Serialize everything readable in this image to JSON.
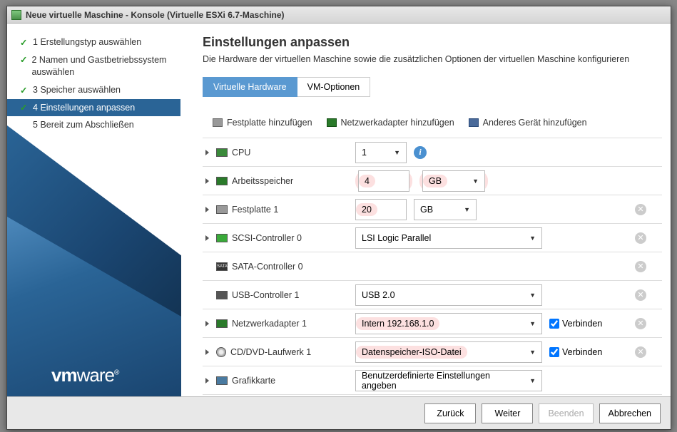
{
  "window": {
    "title": "Neue virtuelle Maschine - Konsole (Virtuelle ESXi 6.7-Maschine)"
  },
  "steps": [
    {
      "num": "1",
      "label": "Erstellungstyp auswählen",
      "done": true
    },
    {
      "num": "2",
      "label": "Namen und Gastbetriebssystem auswählen",
      "done": true
    },
    {
      "num": "3",
      "label": "Speicher auswählen",
      "done": true
    },
    {
      "num": "4",
      "label": "Einstellungen anpassen",
      "active": true
    },
    {
      "num": "5",
      "label": "Bereit zum Abschließen",
      "future": true
    }
  ],
  "main": {
    "heading": "Einstellungen anpassen",
    "desc": "Die Hardware der virtuellen Maschine sowie die zusätzlichen Optionen der virtuellen Maschine konfigurieren"
  },
  "tabs": {
    "hw": "Virtuelle Hardware",
    "opts": "VM-Optionen"
  },
  "toolbar": {
    "add_disk": "Festplatte hinzufügen",
    "add_net": "Netzwerkadapter hinzufügen",
    "add_other": "Anderes Gerät hinzufügen"
  },
  "hw": {
    "cpu": {
      "label": "CPU",
      "value": "1"
    },
    "mem": {
      "label": "Arbeitsspeicher",
      "value": "4",
      "unit": "GB"
    },
    "disk1": {
      "label": "Festplatte 1",
      "value": "20",
      "unit": "GB"
    },
    "scsi": {
      "label": "SCSI-Controller 0",
      "value": "LSI Logic Parallel"
    },
    "sata": {
      "label": "SATA-Controller 0"
    },
    "usb": {
      "label": "USB-Controller 1",
      "value": "USB 2.0"
    },
    "net": {
      "label": "Netzwerkadapter 1",
      "value": "Intern 192.168.1.0",
      "connect": "Verbinden"
    },
    "cd": {
      "label": "CD/DVD-Laufwerk 1",
      "value": "Datenspeicher-ISO-Datei",
      "connect": "Verbinden"
    },
    "video": {
      "label": "Grafikkarte",
      "value": "Benutzerdefinierte Einstellungen angeben"
    }
  },
  "footer": {
    "back": "Zurück",
    "next": "Weiter",
    "finish": "Beenden",
    "cancel": "Abbrechen"
  },
  "logo": {
    "vm": "vm",
    "ware": "ware",
    "reg": "®"
  }
}
